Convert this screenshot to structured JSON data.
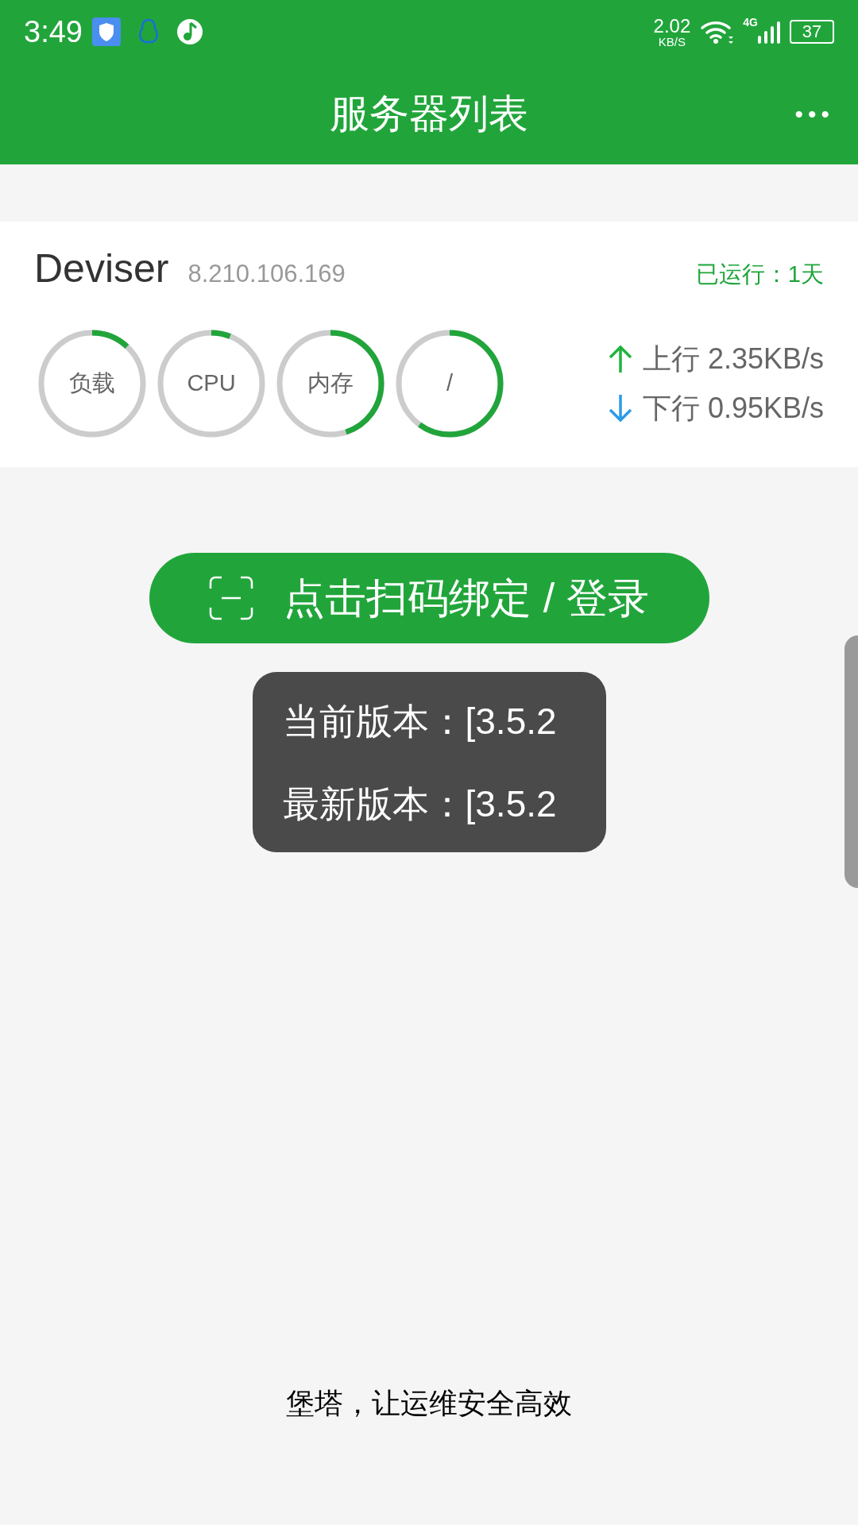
{
  "status_bar": {
    "time": "3:49",
    "net_speed": "2.02",
    "net_unit": "KB/S",
    "network_type": "4G",
    "battery": "37"
  },
  "header": {
    "title": "服务器列表",
    "menu": "•••"
  },
  "server": {
    "name": "Deviser",
    "ip": "8.210.106.169",
    "uptime": "已运行：1天",
    "gauges": [
      {
        "label": "负载",
        "level": 0.12
      },
      {
        "label": "CPU",
        "level": 0.06
      },
      {
        "label": "内存",
        "level": 0.45
      },
      {
        "label": "/",
        "level": 0.6
      }
    ],
    "upload": "上行 2.35KB/s",
    "download": "下行 0.95KB/s"
  },
  "scan_button": {
    "label": "点击扫码绑定 / 登录"
  },
  "version_popup": {
    "current": "当前版本：[3.5.2",
    "latest": "最新版本：[3.5.2"
  },
  "footer": "堡塔，让运维安全高效"
}
